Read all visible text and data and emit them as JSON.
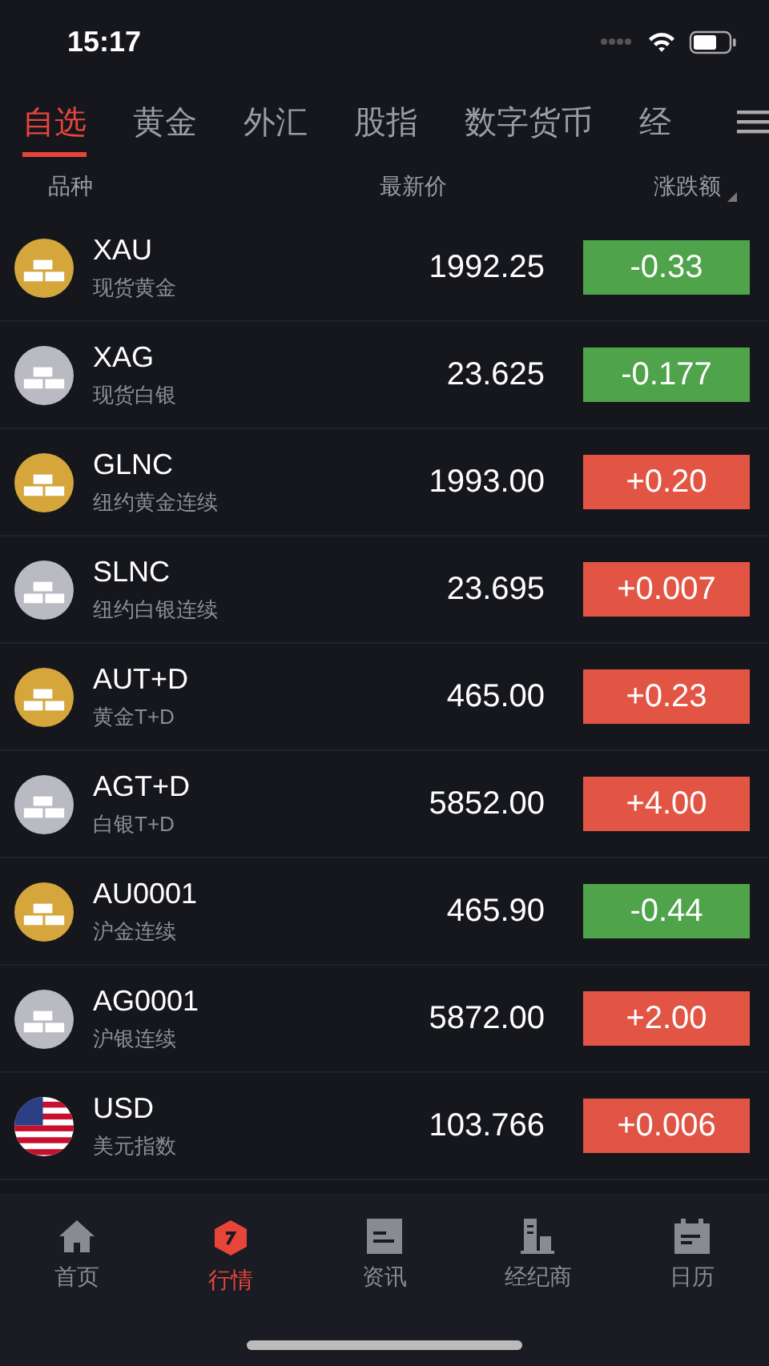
{
  "status_bar": {
    "time": "15:17"
  },
  "tabs": [
    {
      "label": "自选",
      "selected": true
    },
    {
      "label": "黄金",
      "selected": false
    },
    {
      "label": "外汇",
      "selected": false
    },
    {
      "label": "股指",
      "selected": false
    },
    {
      "label": "数字货币",
      "selected": false
    },
    {
      "label": "经",
      "selected": false
    }
  ],
  "columns": [
    "品种",
    "最新价",
    "涨跌额"
  ],
  "rows": [
    {
      "kind": "gold",
      "symbol": "XAU",
      "name": "现货黄金",
      "price": "1992.25",
      "change": "-0.33",
      "color": "#4fa34a"
    },
    {
      "kind": "silver",
      "symbol": "XAG",
      "name": "现货白银",
      "price": "23.625",
      "change": "-0.177",
      "color": "#4fa34a"
    },
    {
      "kind": "gold",
      "symbol": "GLNC",
      "name": "纽约黄金连续",
      "price": "1993.00",
      "change": "+0.20",
      "color": "#e25545"
    },
    {
      "kind": "silver",
      "symbol": "SLNC",
      "name": "纽约白银连续",
      "price": "23.695",
      "change": "+0.007",
      "color": "#e25545"
    },
    {
      "kind": "gold",
      "symbol": "AUT+D",
      "name": "黄金T+D",
      "price": "465.00",
      "change": "+0.23",
      "color": "#e25545"
    },
    {
      "kind": "silver",
      "symbol": "AGT+D",
      "name": "白银T+D",
      "price": "5852.00",
      "change": "+4.00",
      "color": "#e25545"
    },
    {
      "kind": "gold",
      "symbol": "AU0001",
      "name": "沪金连续",
      "price": "465.90",
      "change": "-0.44",
      "color": "#4fa34a"
    },
    {
      "kind": "silver",
      "symbol": "AG0001",
      "name": "沪银连续",
      "price": "5872.00",
      "change": "+2.00",
      "color": "#e25545"
    },
    {
      "kind": "flag",
      "symbol": "USD",
      "name": "美元指数",
      "price": "103.766",
      "change": "+0.006",
      "color": "#df5444"
    }
  ],
  "bottom_nav": [
    {
      "kind": "home",
      "label": "首页",
      "selected": false
    },
    {
      "kind": "market",
      "label": "行情",
      "selected": true
    },
    {
      "kind": "news",
      "label": "资讯",
      "selected": false
    },
    {
      "kind": "broker",
      "label": "经纪商",
      "selected": false
    },
    {
      "kind": "calendar",
      "label": "日历",
      "selected": false
    }
  ]
}
